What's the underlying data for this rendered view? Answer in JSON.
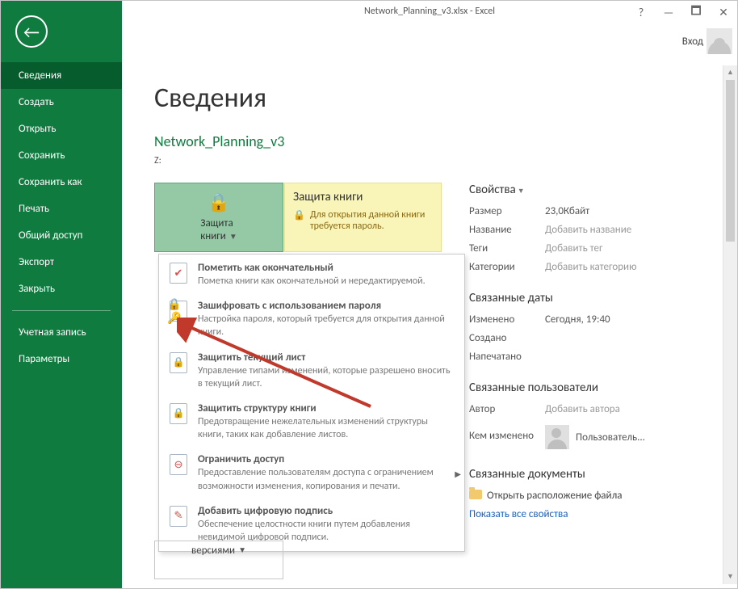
{
  "window": {
    "title": "Network_Planning_v3.xlsx - Excel",
    "signin": "Вход"
  },
  "sidebar": {
    "items": [
      "Сведения",
      "Создать",
      "Открыть",
      "Сохранить",
      "Сохранить как",
      "Печать",
      "Общий доступ",
      "Экспорт",
      "Закрыть"
    ],
    "footer": [
      "Учетная запись",
      "Параметры"
    ],
    "active_index": 0
  },
  "page": {
    "title": "Сведения",
    "file_name": "Network_Planning_v3",
    "file_path": "Z:"
  },
  "protect_button": {
    "line1": "Защита",
    "line2": "книги"
  },
  "yellow": {
    "title": "Защита книги",
    "body": "Для открытия данной книги требуется пароль."
  },
  "menu": [
    {
      "title": "Пометить как окончательный",
      "desc": "Пометка книги как окончательной и нередактируемой.",
      "overlay": "red-ribbon"
    },
    {
      "title": "Зашифровать с использованием пароля",
      "desc": "Настройка пароля, который требуется для открытия данной книги.",
      "overlay": "lock-key"
    },
    {
      "title": "Защитить текущий лист",
      "desc": "Управление типами изменений, которые разрешено вносить в текущий лист.",
      "overlay": "sheet-lock"
    },
    {
      "title": "Защитить структуру книги",
      "desc": "Предотвращение нежелательных изменений структуры книги, таких как добавление листов.",
      "overlay": "sheet-lock"
    },
    {
      "title": "Ограничить доступ",
      "desc": "Предоставление пользователям доступа с ограничением возможности изменения, копирования и печати.",
      "overlay": "red-no",
      "has_submenu": true
    },
    {
      "title": "Добавить цифровую подпись",
      "desc": "Обеспечение целостности книги путем добавления невидимой цифровой подписи.",
      "overlay": "red-ribbon"
    }
  ],
  "manage_versions": {
    "label": "версиями"
  },
  "properties": {
    "header": "Свойства",
    "rows": {
      "size_k": "Размер",
      "size_v": "23,0Кбайт",
      "title_k": "Название",
      "title_v": "Добавить название",
      "tags_k": "Теги",
      "tags_v": "Добавить тег",
      "cats_k": "Категории",
      "cats_v": "Добавить категорию"
    }
  },
  "dates": {
    "header": "Связанные даты",
    "modified_k": "Изменено",
    "modified_v": "Сегодня, 19:40",
    "created_k": "Создано",
    "printed_k": "Напечатано"
  },
  "people": {
    "header": "Связанные пользователи",
    "author_k": "Автор",
    "author_add": "Добавить автора",
    "changer_k": "Кем изменено",
    "user_value": "Пользователь..."
  },
  "docs": {
    "header": "Связанные документы",
    "open_location": "Открыть расположение файла",
    "show_all": "Показать все свойства"
  }
}
